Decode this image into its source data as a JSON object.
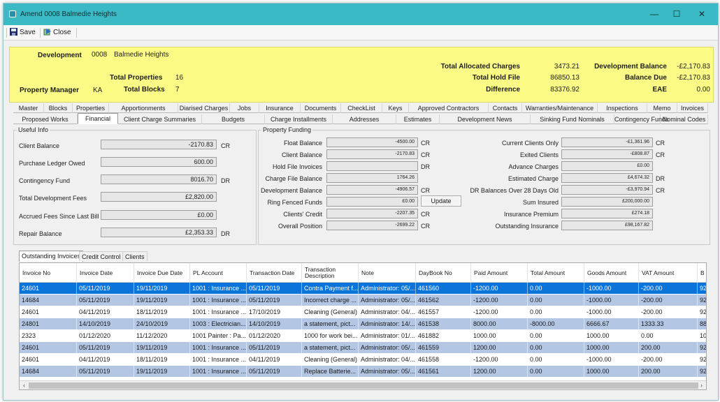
{
  "window": {
    "title": "Amend 0008 Balmedie Heights",
    "minimize": "—",
    "maximize": "☐",
    "close": "✕"
  },
  "toolbar": {
    "save": "Save",
    "close": "Close"
  },
  "header": {
    "development_label": "Development",
    "development_code": "0008",
    "development_name": "Balmedie Heights",
    "total_properties_label": "Total Properties",
    "total_properties": "16",
    "property_manager_label": "Property Manager",
    "property_manager": "KA",
    "total_blocks_label": "Total Blocks",
    "total_blocks": "7",
    "total_allocated_label": "Total Allocated Charges",
    "total_allocated": "3473.21",
    "total_hold_label": "Total Hold File",
    "total_hold": "86850.13",
    "difference_label": "Difference",
    "difference": "83376.92",
    "dev_balance_label": "Development Balance",
    "dev_balance": "-£2,170.83",
    "balance_due_label": "Balance Due",
    "balance_due": "-£2,170.83",
    "eae_label": "EAE",
    "eae": "0.00"
  },
  "tabs_row1": [
    "Master",
    "Blocks",
    "Properties",
    "Apportionments",
    "Diarised Charges",
    "Jobs",
    "Insurance",
    "Documents",
    "CheckList",
    "Keys",
    "Approved Contractors",
    "Contacts",
    "Warranties/Maintenance",
    "Inspections",
    "Memo",
    "Invoices"
  ],
  "tabs_row2": [
    "Proposed Works",
    "Financial",
    "Client Charge Summaries",
    "Budgets",
    "Charge Installments",
    "Addresses",
    "Estimates",
    "Development News",
    "Sinking Fund Nominals",
    "Contingency Funds",
    "Nominal Codes"
  ],
  "useful_info": {
    "legend": "Useful Info",
    "client_balance_label": "Client Balance",
    "client_balance": "-2170.83",
    "client_balance_suffix": "CR",
    "ledger_owed_label": "Purchase Ledger Owed",
    "ledger_owed": "600.00",
    "contingency_label": "Contingency Fund",
    "contingency": "8016.70",
    "contingency_suffix": "DR",
    "dev_fees_label": "Total Development Fees",
    "dev_fees": "£2,820.00",
    "accrued_label": "Accrued Fees Since Last Bill",
    "accrued": "£0.00",
    "repair_label": "Repair Balance",
    "repair": "£2,353.33",
    "repair_suffix": "DR"
  },
  "funding": {
    "legend": "Property Funding",
    "float_label": "Float Balance",
    "float": "-4500.00",
    "float_suffix": "CR",
    "client_bal_label": "Client Balance",
    "client_bal": "-2170.83",
    "client_bal_suffix": "CR",
    "hold_label": "Hold File Invoices",
    "hold": "",
    "hold_suffix": "DR",
    "charge_file_label": "Charge File Balance",
    "charge_file": "1764.26",
    "dev_bal_label": "Development Balance",
    "dev_bal": "-4906.57",
    "dev_bal_suffix": "CR",
    "ring_label": "Ring Fenced Funds",
    "ring": "£0.00",
    "update": "Update",
    "credit_label": "Clients' Credit",
    "credit": "-2207.35",
    "credit_suffix": "CR",
    "overall_label": "Overall Position",
    "overall": "-2699.22",
    "overall_suffix": "CR",
    "current_label": "Current Clients Only",
    "current": "-£1,361.96",
    "current_suffix": "CR",
    "exited_label": "Exited Clients",
    "exited": "-£808.87",
    "exited_suffix": "CR",
    "advance_label": "Advance Charges",
    "advance": "£0.00",
    "estimated_label": "Estimated Charge",
    "estimated": "£4,674.32",
    "estimated_suffix": "DR",
    "dr28_label": "DR Balances Over 28 Days Old",
    "dr28": "-£3,970.94",
    "dr28_suffix": "CR",
    "sum_label": "Sum Insured",
    "sum": "£200,000.00",
    "premium_label": "Insurance Premium",
    "premium": "£274.18",
    "outstanding_label": "Outstanding Insurance",
    "outstanding": "£98,167.82"
  },
  "bottom_tabs": [
    "Outstanding Invoices",
    "Credit Control",
    "Clients"
  ],
  "grid": {
    "columns": [
      "Invoice No",
      "Invoice Date",
      "Invoice Due Date",
      "PL Account",
      "Transaction Date",
      "Transaction Description",
      "Note",
      "DayBook No",
      "Paid Amount",
      "Total Amount",
      "Goods Amount",
      "VAT Amount",
      "B"
    ],
    "rows": [
      [
        "24601",
        "05/11/2019",
        "19/11/2019",
        "1001 : Insurance ...",
        "05/11/2019",
        "Contra Payment f...",
        "Administrator: 05/...",
        "461560",
        "-1200.00",
        "0.00",
        "-1000.00",
        "-200.00",
        "92"
      ],
      [
        "14684",
        "05/11/2019",
        "19/11/2019",
        "1001 : Insurance ...",
        "05/11/2019",
        "Incorrect charge ...",
        "Administrator: 05/...",
        "461562",
        "-1200.00",
        "0.00",
        "-1000.00",
        "-200.00",
        "92"
      ],
      [
        "24601",
        "04/11/2019",
        "18/11/2019",
        "1001 : Insurance ...",
        "17/10/2019",
        "Cleaning (General)",
        "Administrator: 04/...",
        "461557",
        "-1200.00",
        "0.00",
        "-1000.00",
        "-200.00",
        "92"
      ],
      [
        "24801",
        "14/10/2019",
        "24/10/2019",
        "1003 : Electrician...",
        "14/10/2019",
        "a statement, pict...",
        "Administrator: 14/...",
        "461538",
        "8000.00",
        "-8000.00",
        "6666.67",
        "1333.33",
        "88"
      ],
      [
        "2323",
        "01/12/2020",
        "11/12/2020",
        "1001 Painter : Pa...",
        "01/12/2020",
        "1000 for work bei...",
        "Administrator: 01/...",
        "461882",
        "1000.00",
        "0.00",
        "1000.00",
        "0.00",
        "10"
      ],
      [
        "24601",
        "05/11/2019",
        "19/11/2019",
        "1001 : Insurance ...",
        "05/11/2019",
        "a statement, pict...",
        "Administrator: 05/...",
        "461559",
        "1200.00",
        "0.00",
        "1000.00",
        "200.00",
        "92"
      ],
      [
        "24601",
        "04/11/2019",
        "18/11/2019",
        "1001 : Insurance ...",
        "04/11/2019",
        "Cleaning (General)",
        "Administrator: 04/...",
        "461558",
        "-1200.00",
        "0.00",
        "-1000.00",
        "-200.00",
        "92"
      ],
      [
        "14684",
        "05/11/2019",
        "19/11/2019",
        "1001 : Insurance ...",
        "05/11/2019",
        "Replace Batterie...",
        "Administrator: 05/...",
        "461561",
        "1200.00",
        "0.00",
        "1000.00",
        "200.00",
        "92"
      ]
    ]
  },
  "colors": {
    "title_bar": "#3bb9c4",
    "header_bg": "#fbfb85",
    "selected_row": "#0a74da",
    "alt_row": "#b3c6e4"
  }
}
